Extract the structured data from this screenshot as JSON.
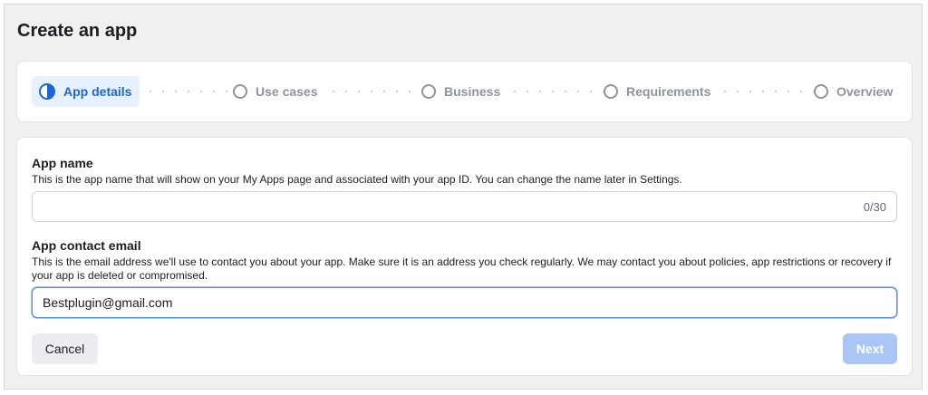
{
  "page": {
    "title": "Create an app"
  },
  "stepper": {
    "steps": [
      {
        "label": "App details",
        "state": "active"
      },
      {
        "label": "Use cases",
        "state": "pending"
      },
      {
        "label": "Business",
        "state": "pending"
      },
      {
        "label": "Requirements",
        "state": "pending"
      },
      {
        "label": "Overview",
        "state": "pending"
      }
    ]
  },
  "form": {
    "app_name": {
      "label": "App name",
      "help": "This is the app name that will show on your My Apps page and associated with your app ID. You can change the name later in Settings.",
      "value": "",
      "counter": "0/30"
    },
    "contact_email": {
      "label": "App contact email",
      "help": "This is the email address we'll use to contact you about your app. Make sure it is an address you check regularly. We may contact you about policies, app restrictions or recovery if your app is deleted or compromised.",
      "value": "Bestplugin@gmail.com"
    },
    "buttons": {
      "cancel": "Cancel",
      "next": "Next"
    }
  },
  "colors": {
    "accent": "#1a66d6",
    "active_step_bg": "#e7f0fd",
    "next_button_disabled": "#a9c6f5",
    "inactive_text": "#8d949e"
  }
}
